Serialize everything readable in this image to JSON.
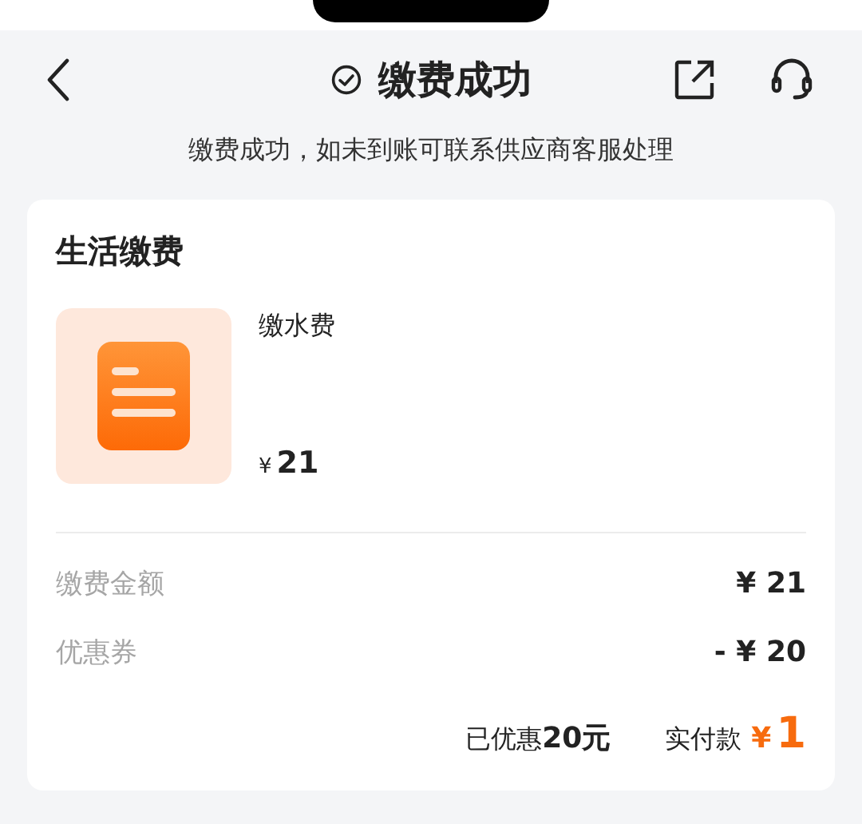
{
  "header": {
    "title": "缴费成功",
    "notice": "缴费成功，如未到账可联系供应商客服处理"
  },
  "card": {
    "title": "生活缴费",
    "item": {
      "name": "缴水费",
      "currency": "¥",
      "price": "21"
    },
    "rows": [
      {
        "label": "缴费金额",
        "value": "¥ 21"
      },
      {
        "label": "优惠券",
        "value": "- ¥ 20"
      }
    ],
    "discount": "已优惠**20元**",
    "payment": {
      "label": "实付款",
      "currency": "¥",
      "amount": "1"
    }
  }
}
